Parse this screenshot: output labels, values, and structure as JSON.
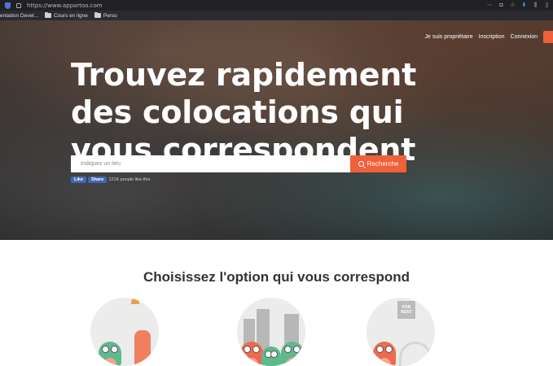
{
  "browser": {
    "url": "https://www.appartoo.com",
    "bookmarks": [
      "entation Devel...",
      "Cours en ligne",
      "Perso"
    ]
  },
  "nav": {
    "items": [
      "Je suis propriétaire",
      "Inscription",
      "Connexion"
    ]
  },
  "hero": {
    "headline": "Trouvez rapidement des colocations qui vous correspondent",
    "search_placeholder": "Indiquez un lieu",
    "search_button": "Recherche",
    "fb_like": "Like",
    "fb_share": "Share",
    "fb_text": "121K people like this."
  },
  "options_section": {
    "title": "Choisissez l'option qui vous correspond"
  },
  "colors": {
    "accent": "#f0603a",
    "facebook": "#4267b2"
  }
}
